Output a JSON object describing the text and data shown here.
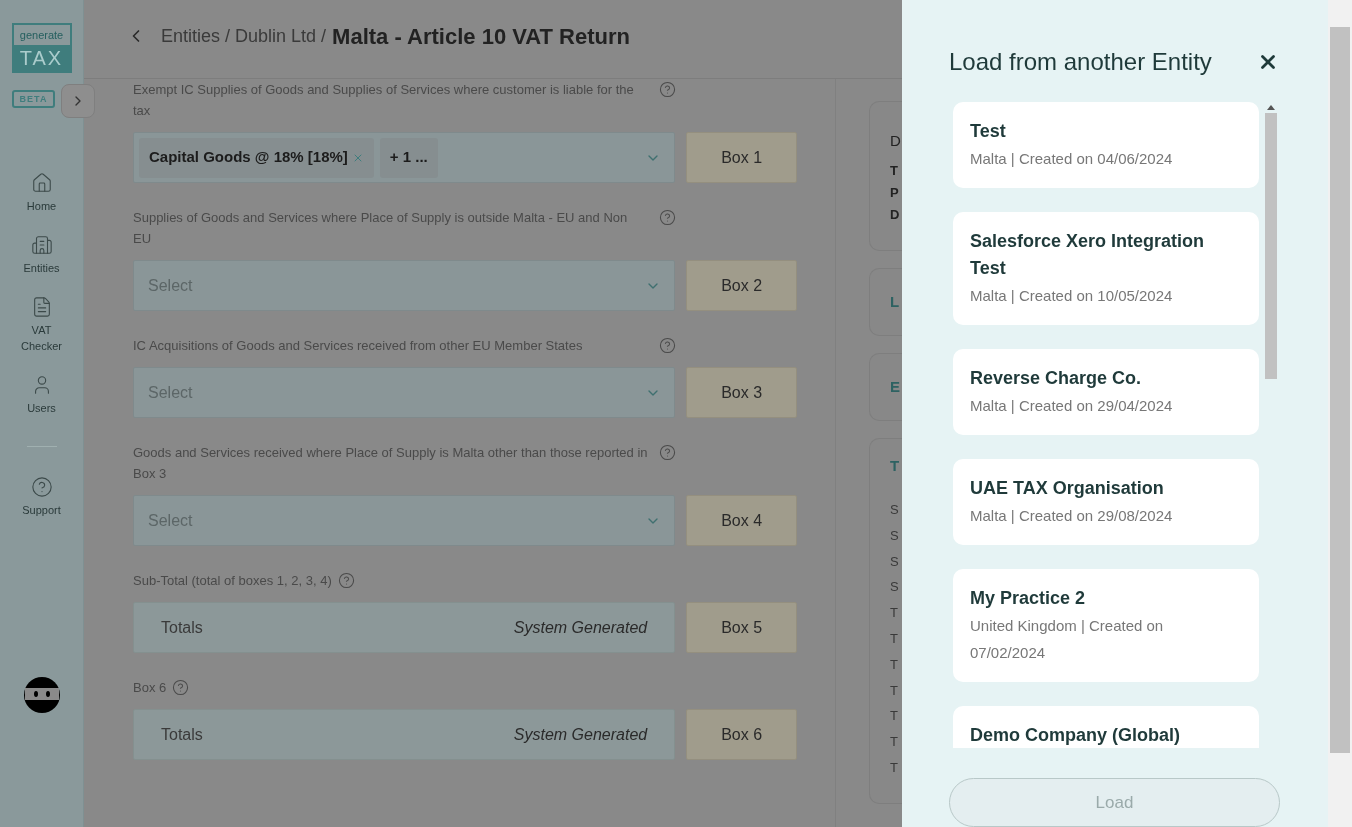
{
  "sidebar": {
    "logo_top": "generate",
    "logo_bottom": "TAX",
    "badge": "BETA",
    "nav": [
      {
        "label": "Home"
      },
      {
        "label": "Entities"
      },
      {
        "label": "VAT Checker"
      },
      {
        "label": "Users"
      }
    ],
    "support": {
      "label": "Support"
    }
  },
  "header": {
    "breadcrumb": "Entities / Dublin Ltd /",
    "title": "Malta - Article 10 VAT Return"
  },
  "form": [
    {
      "kind": "select",
      "label": "Exempt IC Supplies of Goods and Supplies of Services where customer is liable for the tax",
      "chips": [
        {
          "label": "Capital Goods @ 18% [18%]",
          "removable": true
        },
        {
          "label": "+ 1 ...",
          "removable": false
        }
      ],
      "box": "Box 1"
    },
    {
      "kind": "select",
      "label": "Supplies of Goods and Services where Place of Supply is outside Malta - EU and Non EU",
      "placeholder": "Select",
      "box": "Box 2"
    },
    {
      "kind": "select",
      "label": "IC Acquisitions of Goods and Services received from other EU Member States",
      "placeholder": "Select",
      "box": "Box 3"
    },
    {
      "kind": "select",
      "label": "Goods and Services received where Place of Supply is Malta other than those reported in Box 3",
      "placeholder": "Select",
      "box": "Box 4"
    },
    {
      "kind": "totals",
      "label": "Sub-Total (total of boxes 1, 2, 3, 4)",
      "value": "Totals",
      "note": "System Generated",
      "box": "Box 5"
    },
    {
      "kind": "totals",
      "label": "Box 6",
      "value": "Totals",
      "note": "System Generated",
      "box": "Box 6"
    }
  ],
  "side_cards": [
    {
      "title": "D",
      "lines": [
        "T",
        "P",
        "D"
      ]
    },
    {
      "title": "L"
    },
    {
      "title": "E"
    },
    {
      "title": "T",
      "lines": [
        "S",
        "S",
        "S",
        "S",
        "T",
        "T",
        "T",
        "T",
        "T",
        "T",
        "T"
      ]
    }
  ],
  "panel": {
    "title": "Load from another Entity",
    "entities": [
      {
        "name": "Test",
        "meta": "Malta | Created on 04/06/2024"
      },
      {
        "name": "Salesforce Xero Integration Test",
        "meta": "Malta | Created on 10/05/2024"
      },
      {
        "name": "Reverse Charge Co.",
        "meta": "Malta | Created on 29/04/2024"
      },
      {
        "name": "UAE TAX Organisation",
        "meta": "Malta | Created on 29/08/2024"
      },
      {
        "name": "My Practice 2",
        "meta": "United Kingdom | Created on 07/02/2024"
      },
      {
        "name": "Demo Company (Global)"
      }
    ],
    "load_button": {
      "label": "Load",
      "disabled": true
    }
  }
}
